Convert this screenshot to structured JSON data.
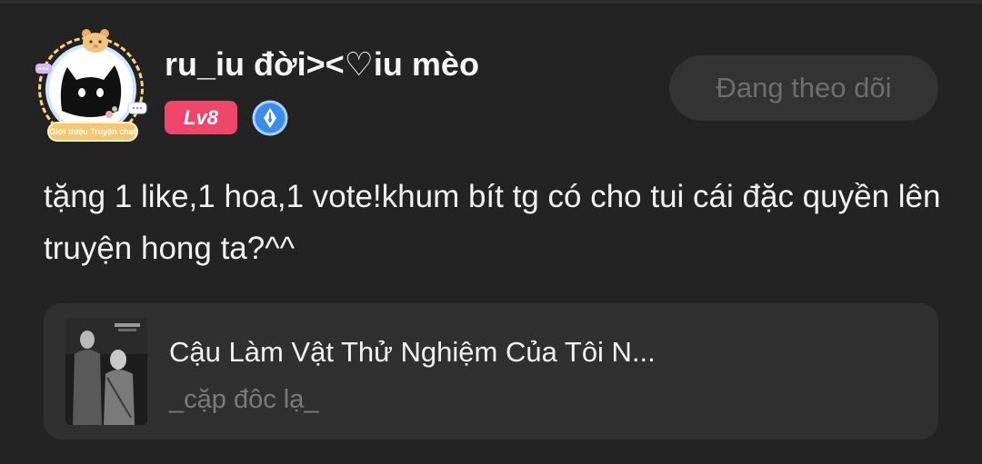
{
  "user": {
    "username": "ru_iu đời><♡iu mèo",
    "level": "Lv8",
    "avatar_frame_text": "Giới thiệu Truyện chat"
  },
  "follow_button": {
    "label": "Đang theo dõi"
  },
  "comment": {
    "text": "tặng 1 like,1 hoa,1 vote!khum bít tg có cho tui cái đặc quyền lên truyện hong ta?^^"
  },
  "story": {
    "title": "Cậu Làm Vật Thử Nghiệm Của Tôi N...",
    "author": "_cặp đôc lạ_"
  },
  "colors": {
    "background": "#232323",
    "level_badge": "#f0466b",
    "pen_badge": "#3a8ee6",
    "follow_button_bg": "#333333",
    "card_bg": "#303030"
  },
  "icons": {
    "avatar": "black-cat-avatar",
    "badge": "pen-nib-badge-icon"
  }
}
